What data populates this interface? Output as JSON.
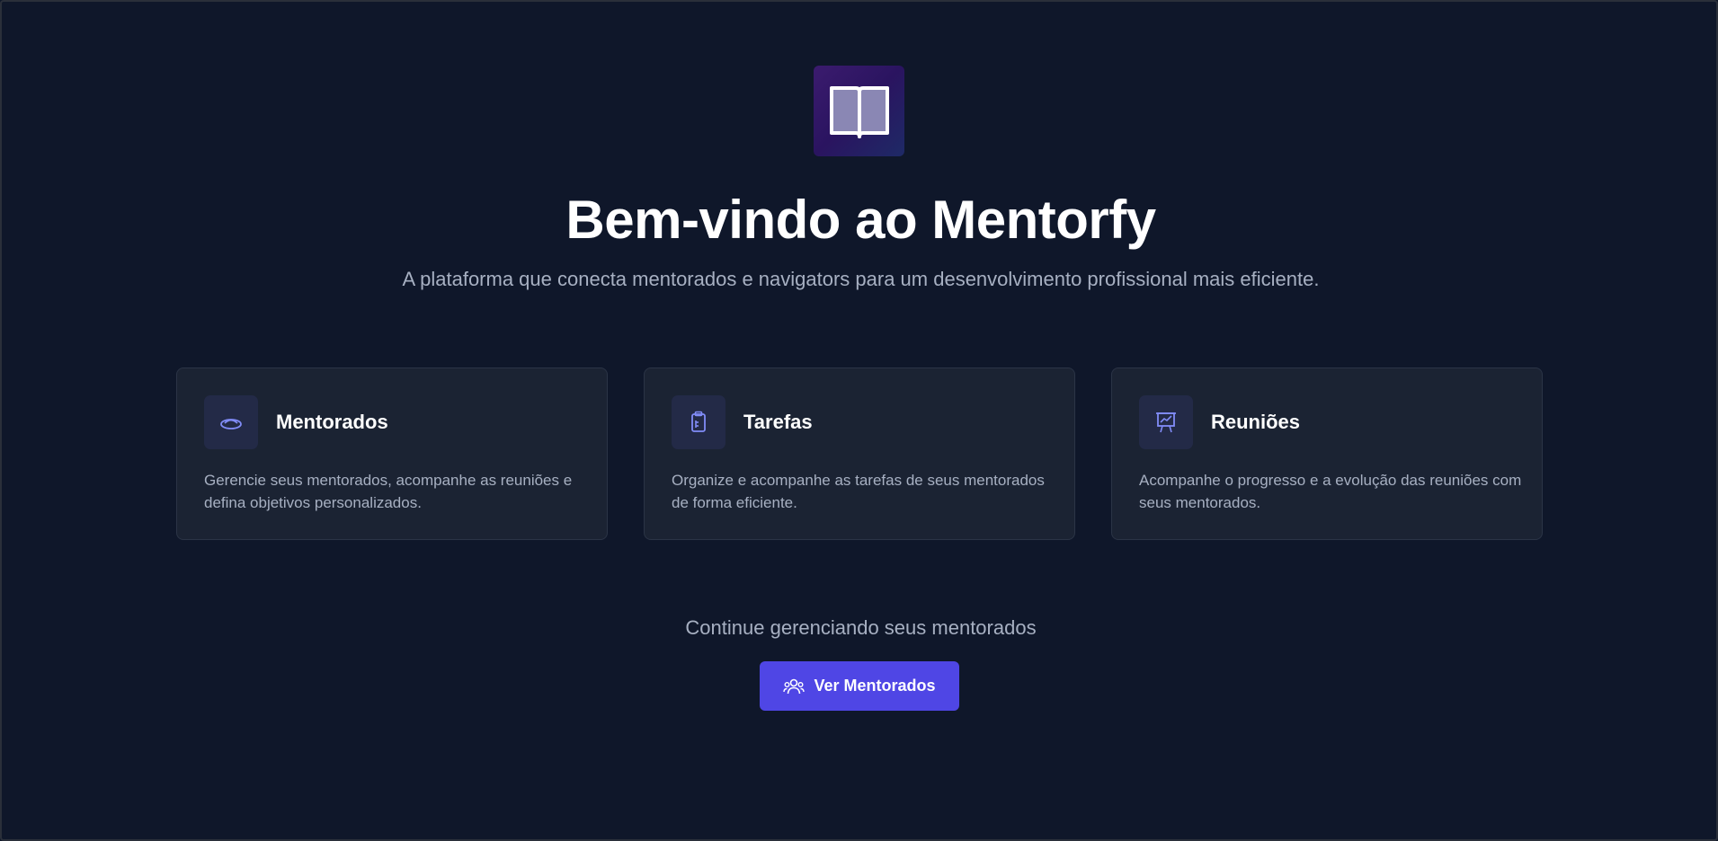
{
  "hero": {
    "logo_icon": "open-book-icon",
    "title": "Bem-vindo ao Mentorfy",
    "subtitle": "A plataforma que conecta mentorados e navigators para um desenvolvimento profissional mais eficiente."
  },
  "features": [
    {
      "icon": "mentee-icon",
      "title": "Mentorados",
      "text": "Gerencie seus mentorados, acompanhe as reuniões e defina objetivos personalizados."
    },
    {
      "icon": "clipboard-icon",
      "title": "Tarefas",
      "text": "Organize e acompanhe as tarefas de seus mentorados de forma eficiente."
    },
    {
      "icon": "presentation-chart-icon",
      "title": "Reuniões",
      "text": "Acompanhe o progresso e a evolução das reuniões com seus mentorados."
    }
  ],
  "cta": {
    "text": "Continue gerenciando seus mentorados",
    "button_label": "Ver Mentorados",
    "button_icon": "users-icon"
  },
  "colors": {
    "background": "#0f172a",
    "card": "#1b2333",
    "accent": "#4f46e5",
    "icon_accent": "#818cf8"
  }
}
